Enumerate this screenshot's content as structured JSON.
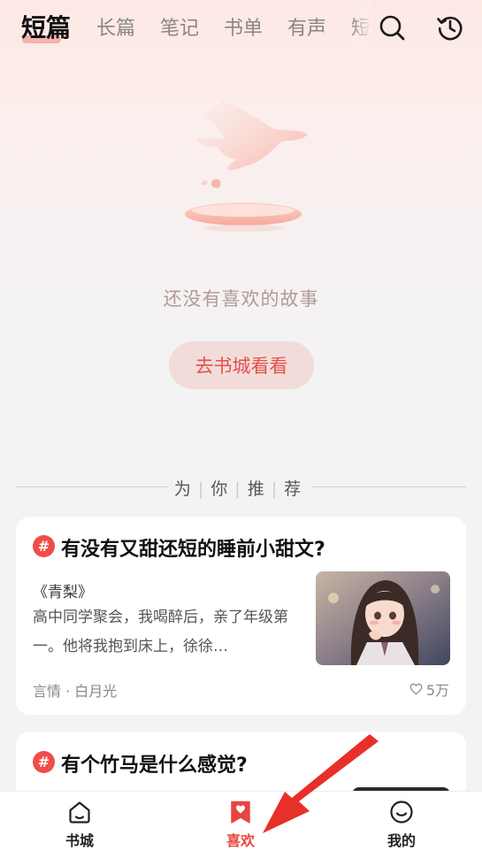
{
  "tabs": {
    "items": [
      "短篇",
      "长篇",
      "笔记",
      "书单",
      "有声",
      "短"
    ],
    "active_index": 0,
    "search_icon": "search-icon",
    "history_icon": "history-icon"
  },
  "empty": {
    "message": "还没有喜欢的故事",
    "button_label": "去书城看看"
  },
  "recommend": {
    "chars": [
      "为",
      "你",
      "推",
      "荐"
    ],
    "separator": "|"
  },
  "cards": [
    {
      "hash": "#",
      "title": "有没有又甜还短的睡前小甜文?",
      "book_name": "《青梨》",
      "description": "高中同学聚会，我喝醉后，亲了年级第一。他将我抱到床上，徐徐…",
      "tags": "言情 · 白月光",
      "likes": "5万"
    },
    {
      "hash": "#",
      "title": "有个竹马是什么感觉?"
    }
  ],
  "bottom_nav": [
    {
      "label": "书城",
      "icon": "home-icon"
    },
    {
      "label": "喜欢",
      "icon": "bookmark-heart-icon"
    },
    {
      "label": "我的",
      "icon": "smiley-icon"
    }
  ],
  "colors": {
    "accent": "#e84540",
    "button_bg": "#f2dcda",
    "hash_red": "#ef4d4a"
  }
}
